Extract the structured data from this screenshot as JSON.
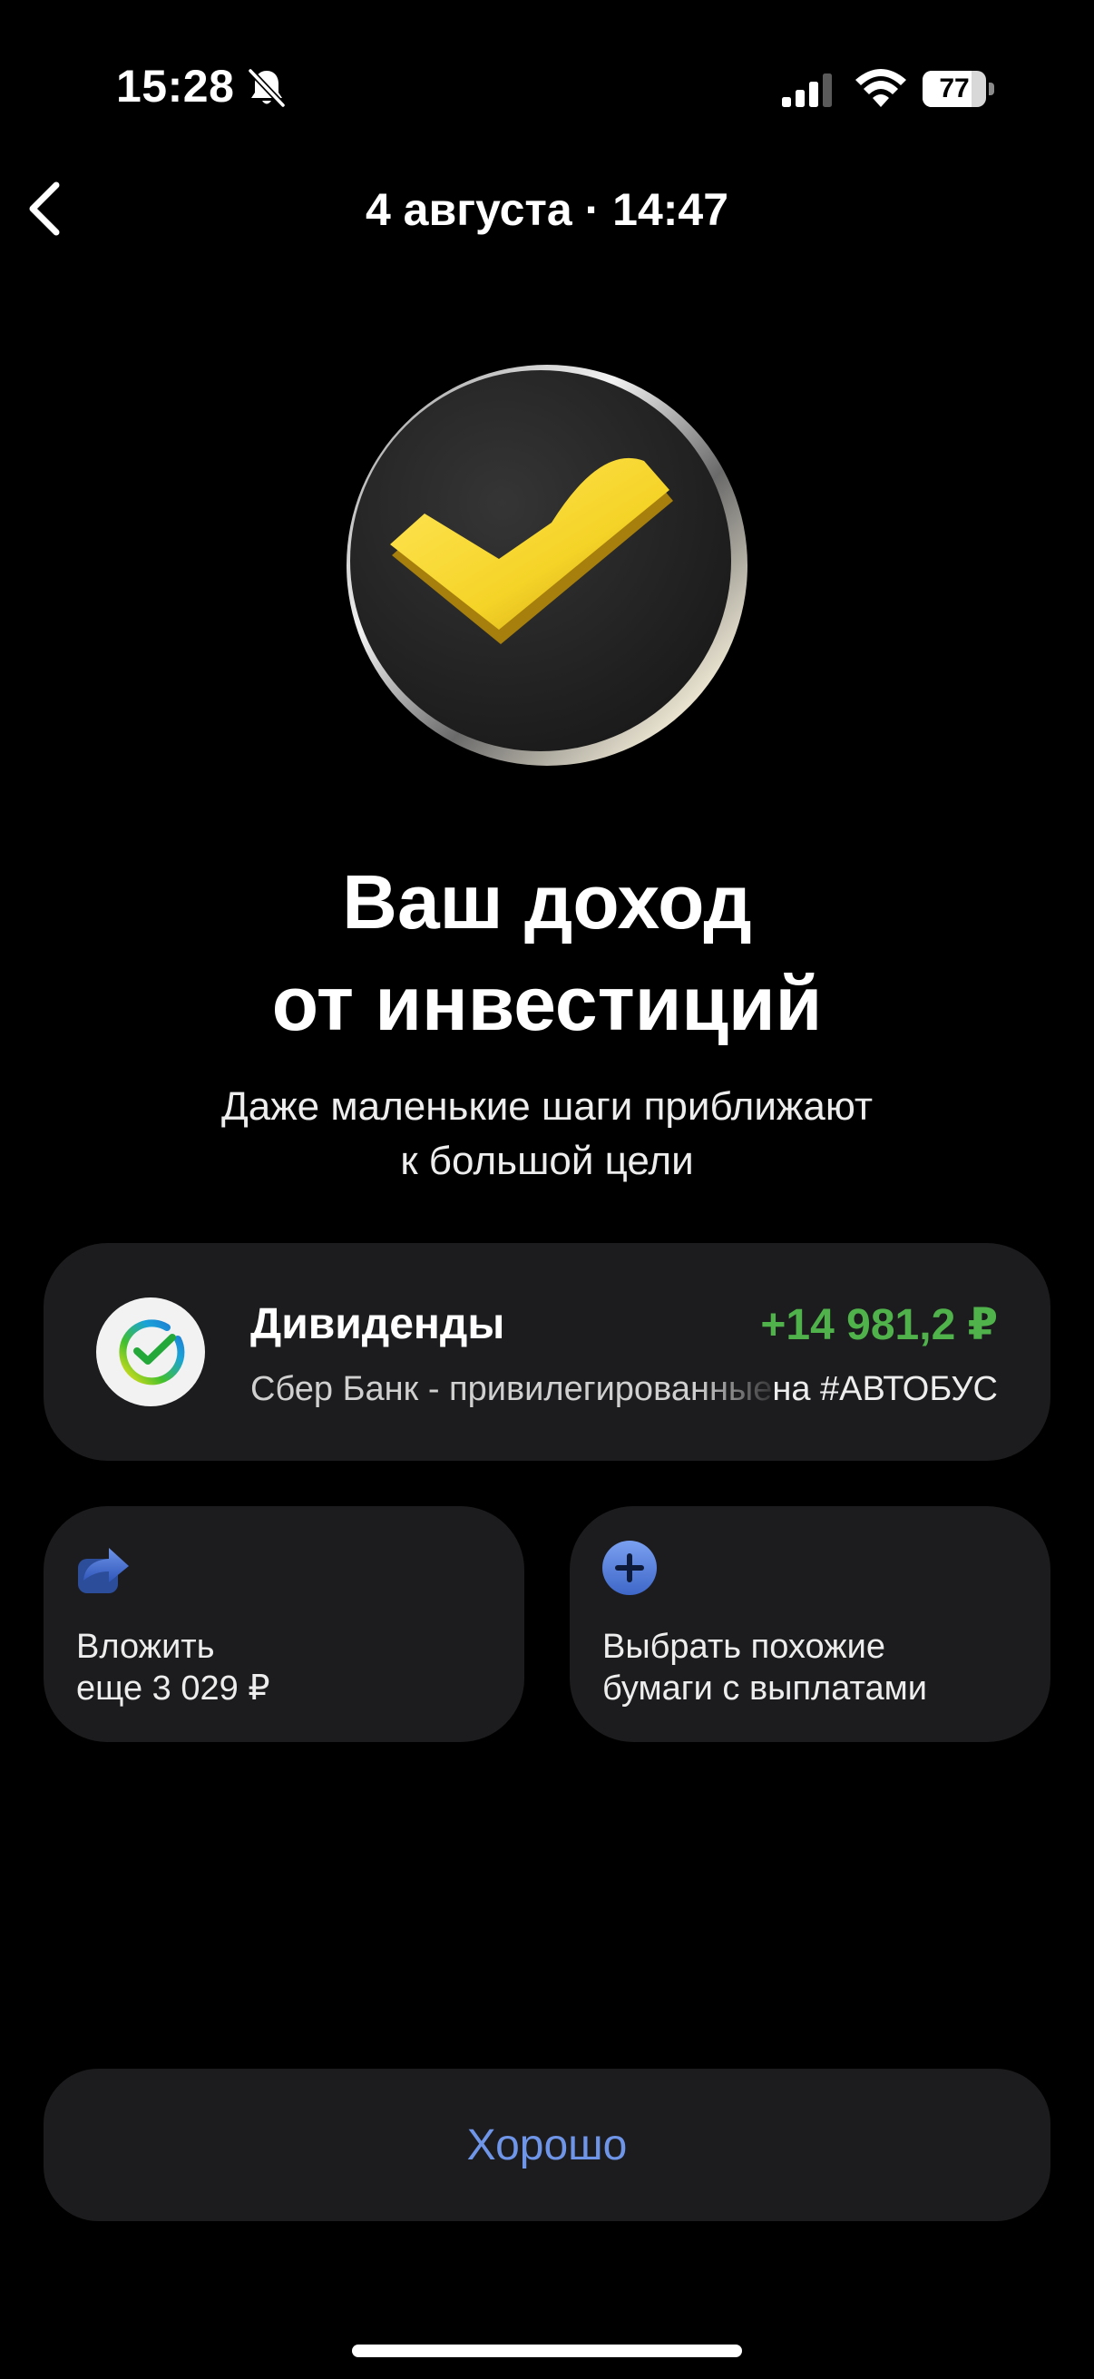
{
  "status_bar": {
    "time": "15:28",
    "battery_level": "77",
    "battery_fraction": 0.77,
    "icons": [
      "bell-slash-icon",
      "cellular-signal-icon",
      "wifi-icon",
      "battery-icon"
    ]
  },
  "header": {
    "back_icon": "chevron-left-icon",
    "title": "4 августа · 14:47"
  },
  "hero": {
    "icon": "checkmark-badge-icon",
    "accent_color": "#f5d327"
  },
  "main": {
    "title_line1": "Ваш доход",
    "title_line2": "от инвестиций",
    "subtitle_line1": "Даже маленькие шаги приближают",
    "subtitle_line2": "к большой цели"
  },
  "dividend": {
    "logo": "sber-logo-icon",
    "title": "Дивиденды",
    "amount": "+14 981,2 ₽",
    "amount_color": "#4fb24a",
    "description": "Сбер Банк - привилегированные",
    "tag": "на #АВТОБУС"
  },
  "actions": [
    {
      "icon": "share-arrow-icon",
      "line1": "Вложить",
      "line2": "еще 3 029 ₽"
    },
    {
      "icon": "plus-circle-icon",
      "line1": "Выбрать похожие",
      "line2": "бумаги с выплатами"
    }
  ],
  "ok_button": {
    "label": "Хорошо",
    "color": "#6f95e8"
  }
}
